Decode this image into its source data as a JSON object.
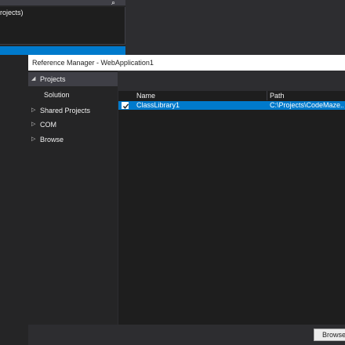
{
  "background": {
    "tree_text": "rojects)"
  },
  "dialog": {
    "title": "Reference Manager - WebApplication1",
    "nav": [
      {
        "label": "Projects",
        "arrow": "◢"
      },
      {
        "label": "Solution"
      },
      {
        "label": "Shared Projects",
        "arrow": "▷"
      },
      {
        "label": "COM",
        "arrow": "▷"
      },
      {
        "label": "Browse",
        "arrow": "▷"
      }
    ],
    "columns": {
      "name": "Name",
      "path": "Path"
    },
    "rows": [
      {
        "checked": true,
        "name": "ClassLibrary1",
        "path": "C:\\Projects\\CodeMaze..."
      }
    ],
    "browse_button": "Browse..."
  },
  "colors": {
    "accent": "#007acc",
    "background": "#2d2d30",
    "panel": "#252526",
    "list": "#1e1e1e"
  }
}
